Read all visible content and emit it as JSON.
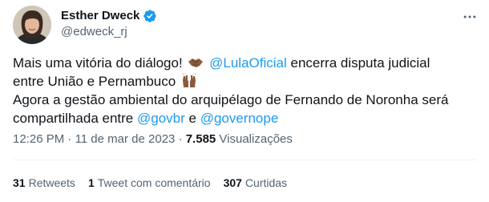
{
  "author": {
    "display_name": "Esther Dweck",
    "handle": "@edweck_rj"
  },
  "icons": {
    "verified": "verified-badge-icon",
    "more": "more-options-icon",
    "handshake": "handshake-emoji",
    "raised_hands": "raised-hands-emoji"
  },
  "colors": {
    "link": "#1d9bf0",
    "text": "#0f1419",
    "secondary": "#536471"
  },
  "tweet": {
    "line1_start": "Mais uma vitória do diálogo!",
    "mention_lula": "@LulaOficial",
    "line1_end": " encerra disputa judicial",
    "line2": "entre União e Pernambuco",
    "line3": "Agora a gestão ambiental do arquipélago de Fernando de Noronha será",
    "line4_start": "compartilhada entre ",
    "mention_govbr": "@govbr",
    "line4_mid": " e ",
    "mention_governope": "@governope"
  },
  "meta": {
    "time": "12:26 PM",
    "sep1": " · ",
    "date": "11 de mar de 2023",
    "sep2": " · ",
    "views_count": "7.585",
    "views_label": " Visualizações"
  },
  "stats": {
    "retweets_count": "31",
    "retweets_label": "Retweets",
    "quotes_count": "1",
    "quotes_label": "Tweet com comentário",
    "likes_count": "307",
    "likes_label": "Curtidas"
  }
}
